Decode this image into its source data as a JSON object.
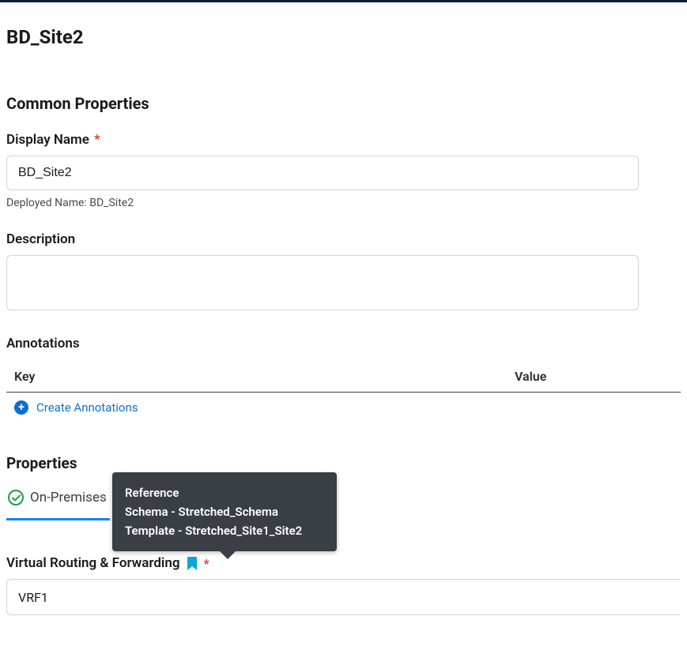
{
  "page_title": "BD_Site2",
  "common_properties": {
    "section_title": "Common Properties",
    "display_name": {
      "label": "Display Name",
      "value": "BD_Site2",
      "deployed_name": "Deployed Name: BD_Site2"
    },
    "description": {
      "label": "Description",
      "value": ""
    },
    "annotations": {
      "label": "Annotations",
      "columns": {
        "key": "Key",
        "value": "Value"
      },
      "create_link": "Create Annotations"
    }
  },
  "properties": {
    "section_title": "Properties",
    "tab": "On-Premises",
    "tooltip": {
      "title": "Reference",
      "schema_line": "Schema - Stretched_Schema",
      "template_line": "Template - Stretched_Site1_Site2"
    },
    "vrf": {
      "label": "Virtual Routing & Forwarding",
      "value": "VRF1"
    }
  }
}
